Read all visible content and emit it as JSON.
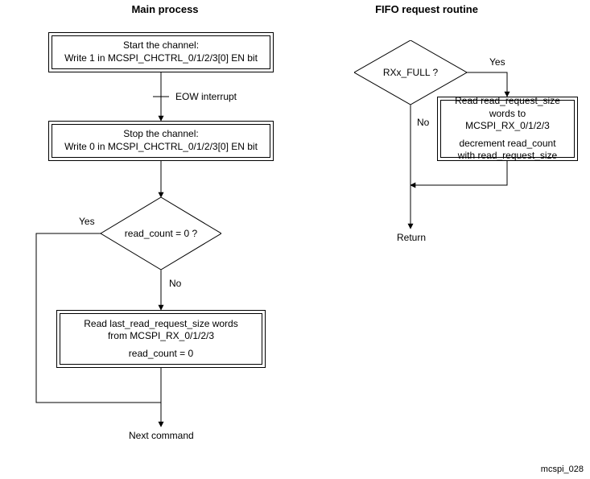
{
  "titles": {
    "main": "Main process",
    "fifo": "FIFO request routine"
  },
  "main": {
    "start_box_l1": "Start the channel:",
    "start_box_l2": "Write 1 in MCSPI_CHCTRL_0/1/2/3[0] EN bit",
    "eow_label": "EOW interrupt",
    "stop_box_l1": "Stop the channel:",
    "stop_box_l2": "Write 0 in MCSPI_CHCTRL_0/1/2/3[0] EN bit",
    "decision": "read_count = 0 ?",
    "decision_yes": "Yes",
    "decision_no": "No",
    "read_box_l1": "Read last_read_request_size words",
    "read_box_l2": "from MCSPI_RX_0/1/2/3",
    "read_box_l3": "read_count = 0",
    "next_cmd": "Next command"
  },
  "fifo": {
    "decision": "RXx_FULL ?",
    "decision_yes": "Yes",
    "decision_no": "No",
    "action_l1": "Read read_request_size",
    "action_l2": "words to MCSPI_RX_0/1/2/3",
    "action_l3": "decrement read_count",
    "action_l4": "with read_request_size",
    "return": "Return"
  },
  "footer_id": "mcspi_028",
  "chart_data": {
    "type": "flowchart",
    "processes": [
      {
        "name": "Main process",
        "nodes": [
          {
            "id": "start",
            "type": "process",
            "text": "Start the channel: Write 1 in MCSPI_CHCTRL_0/1/2/3[0] EN bit"
          },
          {
            "id": "stop",
            "type": "process",
            "text": "Stop the channel: Write 0 in MCSPI_CHCTRL_0/1/2/3[0] EN bit"
          },
          {
            "id": "dec",
            "type": "decision",
            "text": "read_count = 0 ?"
          },
          {
            "id": "read",
            "type": "process",
            "text": "Read last_read_request_size words from MCSPI_RX_0/1/2/3; read_count = 0"
          },
          {
            "id": "next",
            "type": "terminator",
            "text": "Next command"
          }
        ],
        "edges": [
          {
            "from": "start",
            "to": "stop",
            "label": "EOW interrupt"
          },
          {
            "from": "stop",
            "to": "dec"
          },
          {
            "from": "dec",
            "to": "next",
            "label": "Yes"
          },
          {
            "from": "dec",
            "to": "read",
            "label": "No"
          },
          {
            "from": "read",
            "to": "next"
          }
        ]
      },
      {
        "name": "FIFO request routine",
        "nodes": [
          {
            "id": "fdec",
            "type": "decision",
            "text": "RXx_FULL ?"
          },
          {
            "id": "faction",
            "type": "process",
            "text": "Read read_request_size words to MCSPI_RX_0/1/2/3; decrement read_count with read_request_size"
          },
          {
            "id": "fret",
            "type": "terminator",
            "text": "Return"
          }
        ],
        "edges": [
          {
            "from": "fdec",
            "to": "faction",
            "label": "Yes"
          },
          {
            "from": "fdec",
            "to": "fret",
            "label": "No"
          },
          {
            "from": "faction",
            "to": "fret"
          }
        ]
      }
    ]
  }
}
